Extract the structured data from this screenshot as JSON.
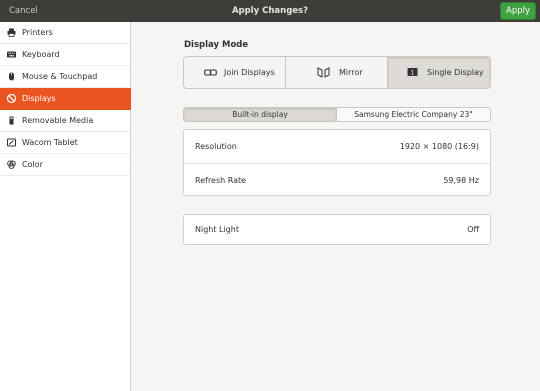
{
  "header": {
    "cancel_label": "Cancel",
    "title": "Apply Changes?",
    "apply_label": "Apply"
  },
  "sidebar": {
    "items": [
      {
        "label": "Printers",
        "icon": "printer-icon",
        "active": false
      },
      {
        "label": "Keyboard",
        "icon": "keyboard-icon",
        "active": false
      },
      {
        "label": "Mouse & Touchpad",
        "icon": "mouse-icon",
        "active": false
      },
      {
        "label": "Displays",
        "icon": "display-icon",
        "active": true
      },
      {
        "label": "Removable Media",
        "icon": "removable-media-icon",
        "active": false
      },
      {
        "label": "Wacom Tablet",
        "icon": "tablet-icon",
        "active": false
      },
      {
        "label": "Color",
        "icon": "color-icon",
        "active": false
      }
    ]
  },
  "display_mode": {
    "title": "Display Mode",
    "options": [
      {
        "label": "Join Displays",
        "icon": "join-displays-icon",
        "active": false
      },
      {
        "label": "Mirror",
        "icon": "mirror-icon",
        "active": false
      },
      {
        "label": "Single Display",
        "icon": "single-display-icon",
        "active": true
      }
    ]
  },
  "display_tabs": [
    {
      "label": "Built-in display",
      "active": true
    },
    {
      "label": "Samsung Electric Company 23\"",
      "active": false
    }
  ],
  "settings": {
    "resolution_label": "Resolution",
    "resolution_value": "1920 × 1080 (16:9)",
    "refresh_label": "Refresh Rate",
    "refresh_value": "59,98 Hz"
  },
  "night_light": {
    "label": "Night Light",
    "value": "Off"
  },
  "colors": {
    "accent": "#e95420",
    "apply_green": "#3fa13f",
    "headerbar": "#3e3d39"
  }
}
